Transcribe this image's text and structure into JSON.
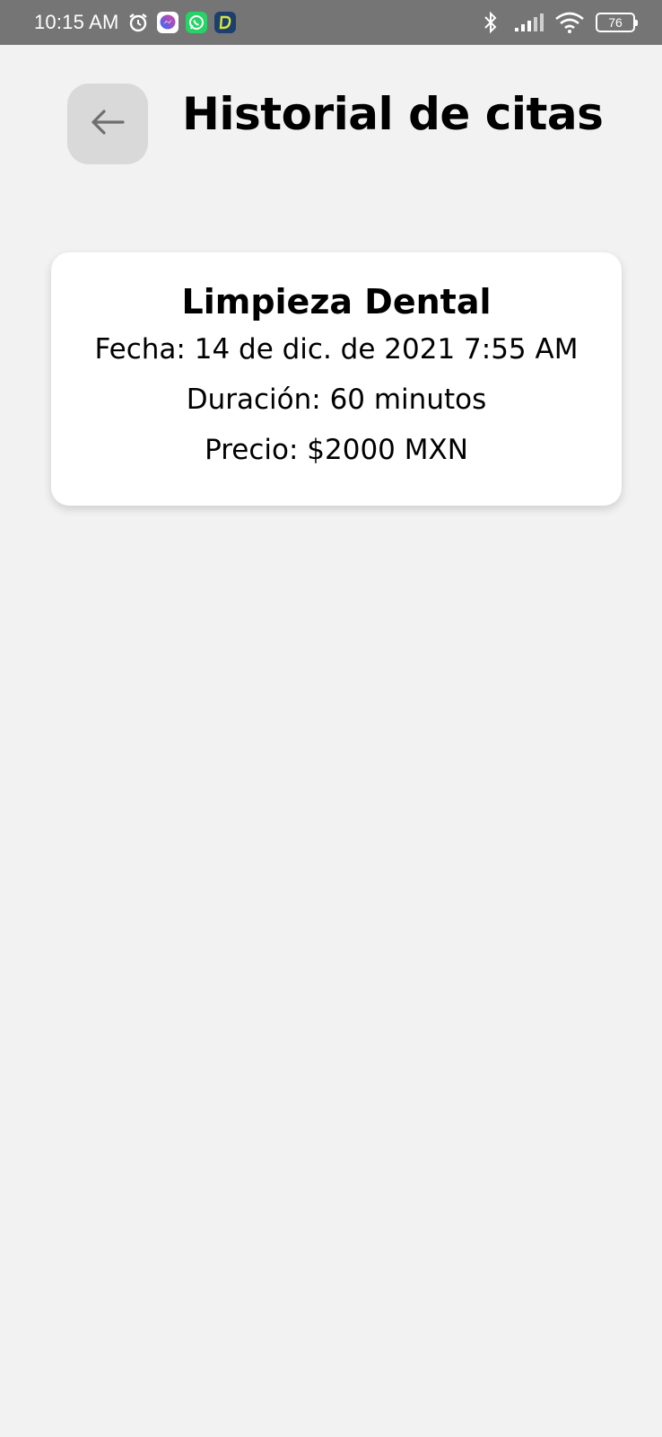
{
  "status_bar": {
    "time": "10:15 AM",
    "battery_level": "76",
    "icons": [
      "alarm-icon",
      "messenger-icon",
      "whatsapp-icon",
      "dental-app-icon",
      "bluetooth-icon",
      "signal-icon",
      "wifi-icon",
      "battery-icon"
    ]
  },
  "header": {
    "title": "Historial de citas",
    "back_icon": "arrow-left-icon"
  },
  "appointments": [
    {
      "service": "Limpieza Dental",
      "date_line": "Fecha: 14 de dic. de 2021 7:55 AM",
      "duration_line": "Duración: 60 minutos",
      "price_line": "Precio: $2000 MXN"
    }
  ],
  "colors": {
    "background": "#f2f2f2",
    "status_bar": "#757575",
    "back_button_bg": "#d9d9d9",
    "card_bg": "#ffffff",
    "text": "#000000"
  }
}
